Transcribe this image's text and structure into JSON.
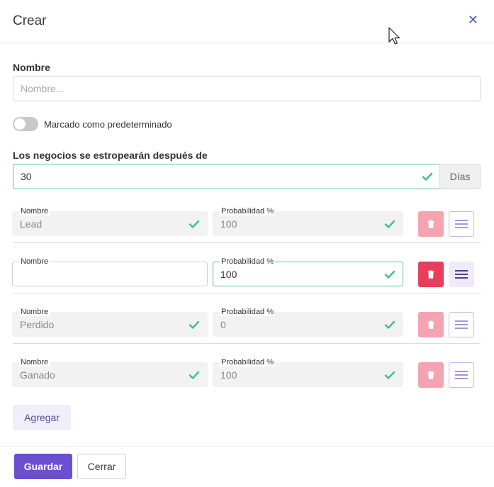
{
  "modal": {
    "title": "Crear",
    "close_icon": "close-icon"
  },
  "form": {
    "name_label": "Nombre",
    "name_placeholder": "Nombre...",
    "name_value": "",
    "default_toggle_label": "Marcado como predeterminado",
    "default_toggle_on": false,
    "rot_label": "Los negocios se estropearán después de",
    "rot_value": "30",
    "rot_unit": "Días"
  },
  "stages": {
    "name_label": "Nombre",
    "prob_label": "Probabilidad %",
    "rows": [
      {
        "name": "Lead",
        "probability": "100",
        "editable": false
      },
      {
        "name": "",
        "probability": "100",
        "editable": true
      },
      {
        "name": "Perdido",
        "probability": "0",
        "editable": false
      },
      {
        "name": "Ganado",
        "probability": "100",
        "editable": false
      }
    ]
  },
  "actions": {
    "add_label": "Agregar",
    "save_label": "Guardar",
    "close_label": "Cerrar"
  },
  "colors": {
    "accent": "#6c4fd0",
    "success": "#3fbf83",
    "danger": "#e83e5b"
  }
}
